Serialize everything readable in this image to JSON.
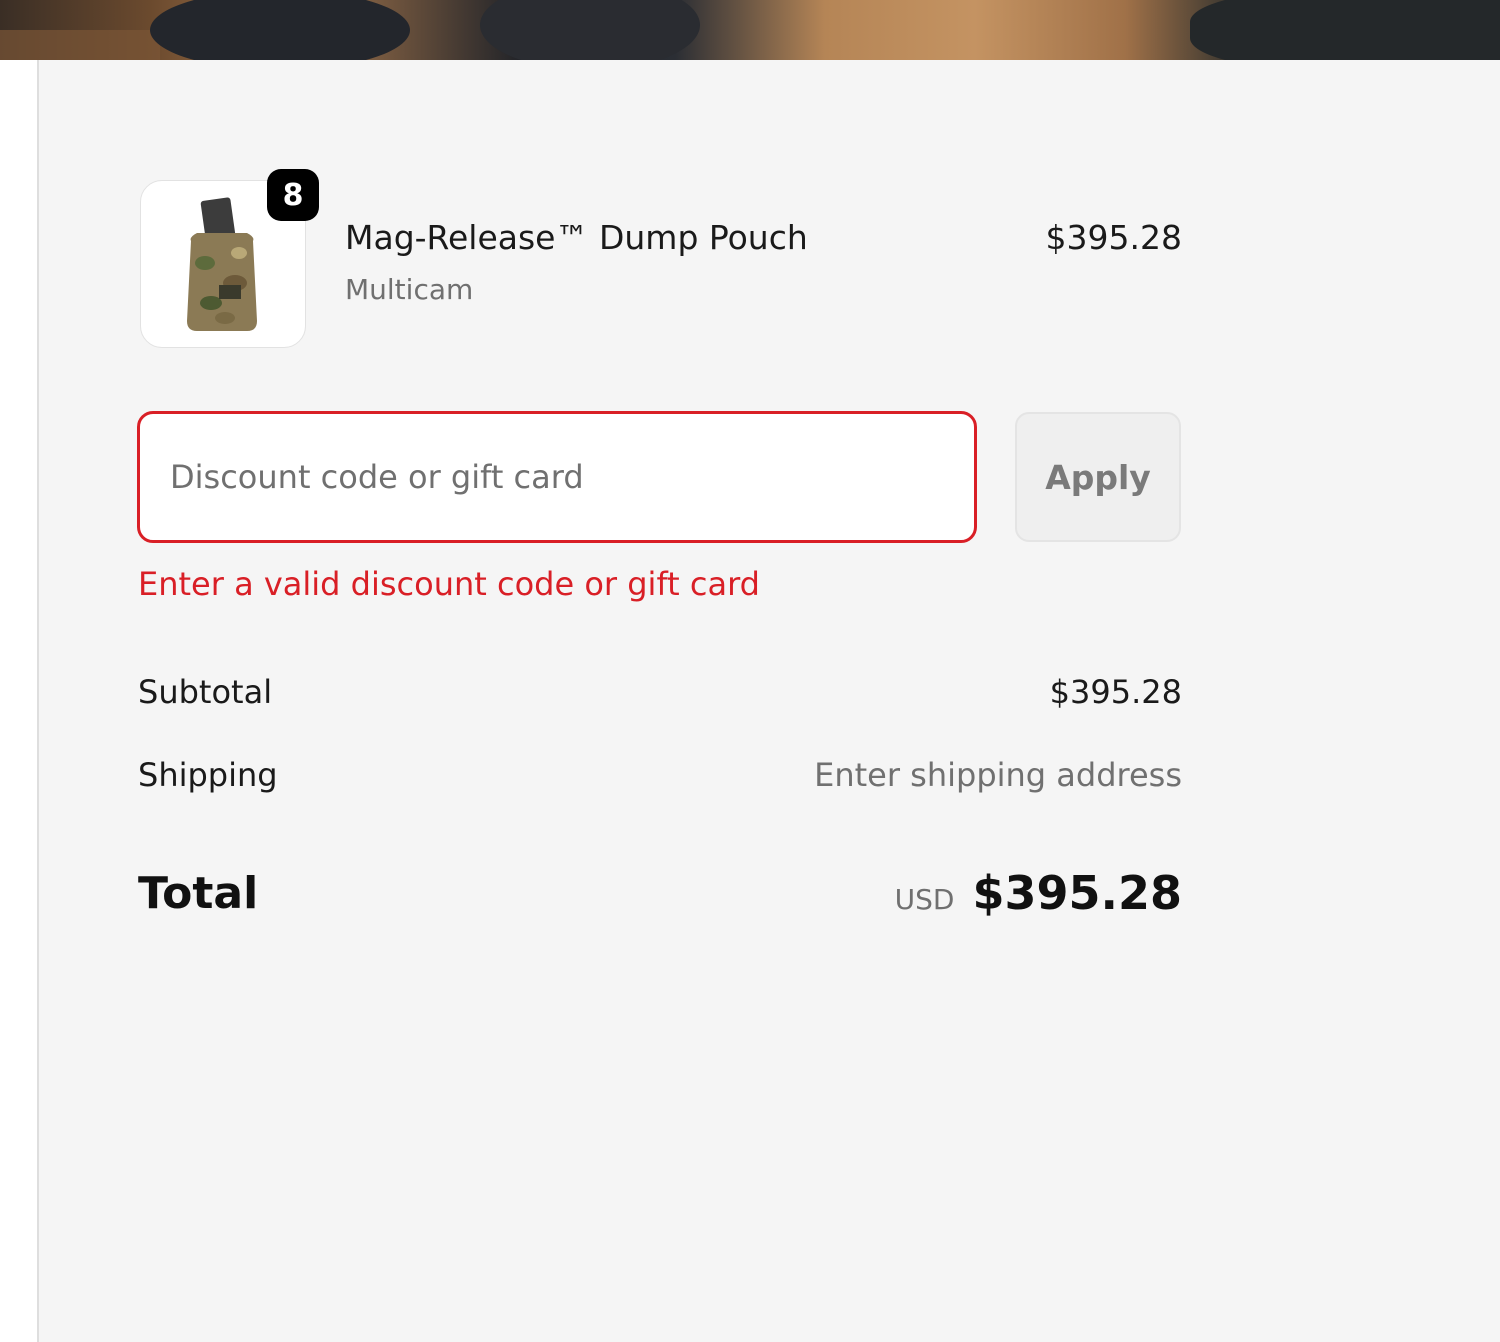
{
  "line_item": {
    "name": "Mag-Release™ Dump Pouch",
    "variant": "Multicam",
    "price": "$395.28",
    "quantity": "8"
  },
  "discount": {
    "placeholder": "Discount code or gift card",
    "value": "",
    "apply_label": "Apply",
    "error": "Enter a valid discount code or gift card"
  },
  "summary": {
    "subtotal_label": "Subtotal",
    "subtotal_value": "$395.28",
    "shipping_label": "Shipping",
    "shipping_value": "Enter shipping address",
    "total_label": "Total",
    "currency": "USD",
    "total_value": "$395.28"
  },
  "colors": {
    "error": "#d91f26",
    "background": "#f5f5f5"
  }
}
